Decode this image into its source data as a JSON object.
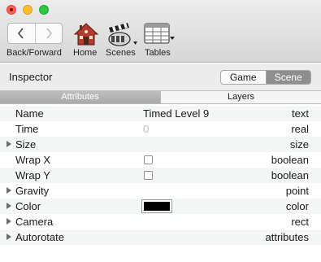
{
  "toolbar": {
    "nav_label": "Back/Forward",
    "home_label": "Home",
    "scenes_label": "Scenes",
    "tables_label": "Tables"
  },
  "inspector": {
    "title": "Inspector",
    "segments": [
      {
        "label": "Game",
        "selected": false
      },
      {
        "label": "Scene",
        "selected": true
      }
    ]
  },
  "tabs": [
    {
      "label": "Attributes",
      "selected": true
    },
    {
      "label": "Layers",
      "selected": false
    }
  ],
  "properties": [
    {
      "name": "Name",
      "value": "Timed Level 9",
      "type": "text",
      "expandable": false,
      "control": "text"
    },
    {
      "name": "Time",
      "value": "0",
      "type": "real",
      "expandable": false,
      "control": "placeholder"
    },
    {
      "name": "Size",
      "value": "",
      "type": "size",
      "expandable": true,
      "control": "none"
    },
    {
      "name": "Wrap X",
      "value": "",
      "type": "boolean",
      "expandable": false,
      "control": "checkbox",
      "checked": false
    },
    {
      "name": "Wrap Y",
      "value": "",
      "type": "boolean",
      "expandable": false,
      "control": "checkbox",
      "checked": false
    },
    {
      "name": "Gravity",
      "value": "",
      "type": "point",
      "expandable": true,
      "control": "none"
    },
    {
      "name": "Color",
      "value": "",
      "type": "color",
      "expandable": true,
      "control": "color",
      "color_value": "#000000"
    },
    {
      "name": "Camera",
      "value": "",
      "type": "rect",
      "expandable": true,
      "control": "none"
    },
    {
      "name": "Autorotate",
      "value": "",
      "type": "attributes",
      "expandable": true,
      "control": "none"
    }
  ],
  "colors": {
    "accent_segment": "#8e8e8e",
    "tab_active": "#b0b0b0",
    "close": "#fc5f57",
    "minimize": "#fdbc2e",
    "maximize": "#29c840"
  }
}
